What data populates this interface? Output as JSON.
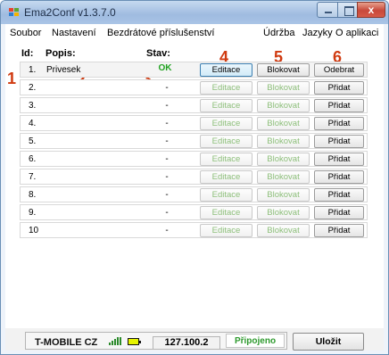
{
  "window": {
    "title": "Ema2Conf v1.3.7.0",
    "close_glyph": "x"
  },
  "menu": {
    "left": [
      "Soubor",
      "Nastavení",
      "Bezdrátové příslušenství"
    ],
    "right": [
      "Údržba",
      "Jazyky",
      "O aplikaci"
    ]
  },
  "headers": {
    "id": "Id:",
    "popis": "Popis:",
    "stav": "Stav:"
  },
  "annotations": [
    "1",
    "2",
    "3",
    "4",
    "5",
    "6"
  ],
  "rows": [
    {
      "id": "1.",
      "popis": "Privesek",
      "stav": "OK",
      "edit": "Editace",
      "block": "Blokovat",
      "action": "Odebrat",
      "enabled": true
    },
    {
      "id": "2.",
      "popis": "",
      "stav": "-",
      "edit": "Editace",
      "block": "Blokovat",
      "action": "Přidat",
      "enabled": false
    },
    {
      "id": "3.",
      "popis": "",
      "stav": "-",
      "edit": "Editace",
      "block": "Blokovat",
      "action": "Přidat",
      "enabled": false
    },
    {
      "id": "4.",
      "popis": "",
      "stav": "-",
      "edit": "Editace",
      "block": "Blokovat",
      "action": "Přidat",
      "enabled": false
    },
    {
      "id": "5.",
      "popis": "",
      "stav": "-",
      "edit": "Editace",
      "block": "Blokovat",
      "action": "Přidat",
      "enabled": false
    },
    {
      "id": "6.",
      "popis": "",
      "stav": "-",
      "edit": "Editace",
      "block": "Blokovat",
      "action": "Přidat",
      "enabled": false
    },
    {
      "id": "7.",
      "popis": "",
      "stav": "-",
      "edit": "Editace",
      "block": "Blokovat",
      "action": "Přidat",
      "enabled": false
    },
    {
      "id": "8.",
      "popis": "",
      "stav": "-",
      "edit": "Editace",
      "block": "Blokovat",
      "action": "Přidat",
      "enabled": false
    },
    {
      "id": "9.",
      "popis": "",
      "stav": "-",
      "edit": "Editace",
      "block": "Blokovat",
      "action": "Přidat",
      "enabled": false
    },
    {
      "id": "10",
      "popis": "",
      "stav": "-",
      "edit": "Editace",
      "block": "Blokovat",
      "action": "Přidat",
      "enabled": false
    }
  ],
  "status": {
    "operator": "T-MOBILE CZ",
    "ip": "127.100.2",
    "connection": "Připojeno",
    "save": "Uložit",
    "signal_icon": "signal-bars-icon",
    "battery_icon": "battery-icon"
  },
  "colors": {
    "ok": "#22a322",
    "annotation": "#d03a10",
    "connected": "#2e9a2e"
  }
}
